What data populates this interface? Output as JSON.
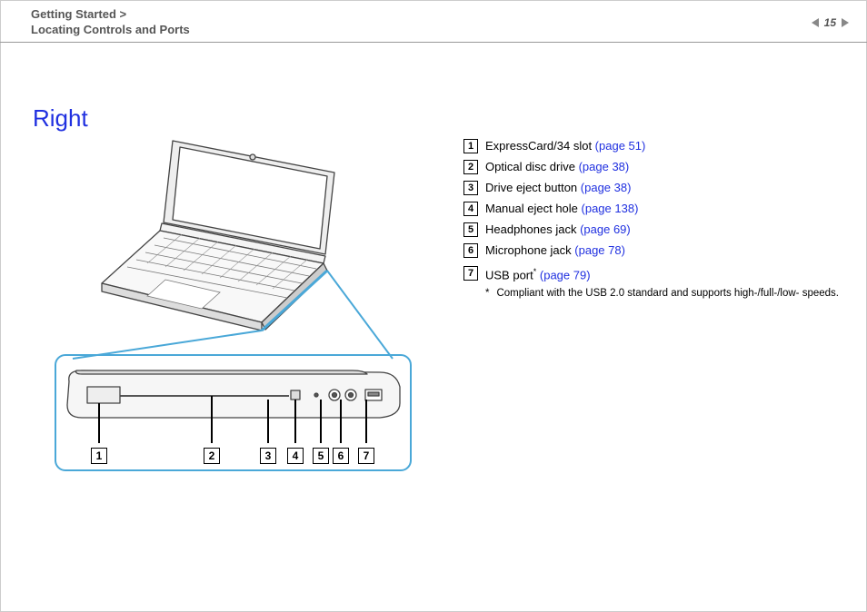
{
  "header": {
    "breadcrumb_line1": "Getting Started >",
    "breadcrumb_line2": "Locating Controls and Ports",
    "page_number": "15"
  },
  "section_title": "Right",
  "legend": [
    {
      "n": "1",
      "label": "ExpressCard/34 slot ",
      "ref": "(page 51)",
      "sup": ""
    },
    {
      "n": "2",
      "label": "Optical disc drive ",
      "ref": "(page 38)",
      "sup": ""
    },
    {
      "n": "3",
      "label": "Drive eject button ",
      "ref": "(page 38)",
      "sup": ""
    },
    {
      "n": "4",
      "label": "Manual eject hole ",
      "ref": "(page 138)",
      "sup": ""
    },
    {
      "n": "5",
      "label": "Headphones jack ",
      "ref": "(page 69)",
      "sup": ""
    },
    {
      "n": "6",
      "label": "Microphone jack ",
      "ref": "(page 78)",
      "sup": ""
    },
    {
      "n": "7",
      "label": "USB port",
      "ref": "(page 79)",
      "sup": "*"
    }
  ],
  "footnote": {
    "mark": "*",
    "text": "Compliant with the USB 2.0 standard and supports high-/full-/low- speeds."
  },
  "callout_numbers": [
    "1",
    "2",
    "3",
    "4",
    "5",
    "6",
    "7"
  ]
}
